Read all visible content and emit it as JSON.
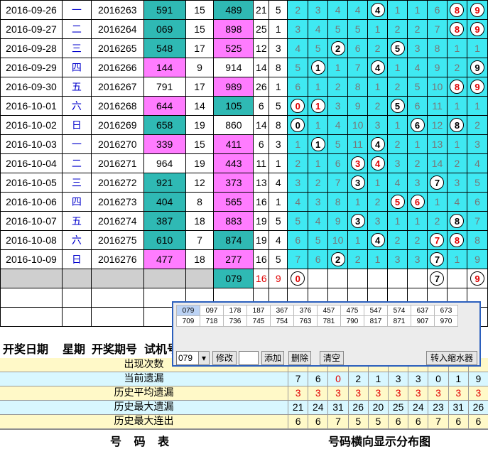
{
  "rows": [
    {
      "date": "2016-09-26",
      "wd": "一",
      "issue": "2016263",
      "test": "591",
      "tt": "teal",
      "s1": "15",
      "draw": "489",
      "dc": "teal",
      "a": "21",
      "b": "5",
      "d": [
        {
          "v": "2"
        },
        {
          "v": "3"
        },
        {
          "v": "4"
        },
        {
          "v": "4"
        },
        {
          "v": "4",
          "ball": true
        },
        {
          "v": "1"
        },
        {
          "v": "1"
        },
        {
          "v": "6"
        },
        {
          "v": "8",
          "ball": true,
          "red": true
        },
        {
          "v": "9",
          "ball": true,
          "red": true
        }
      ]
    },
    {
      "date": "2016-09-27",
      "wd": "二",
      "issue": "2016264",
      "test": "069",
      "tt": "teal",
      "s1": "15",
      "draw": "898",
      "dc": "pink",
      "a": "25",
      "b": "1",
      "d": [
        {
          "v": "3"
        },
        {
          "v": "4"
        },
        {
          "v": "5"
        },
        {
          "v": "5"
        },
        {
          "v": "1"
        },
        {
          "v": "2"
        },
        {
          "v": "2"
        },
        {
          "v": "7"
        },
        {
          "v": "8",
          "ball": true,
          "red": true
        },
        {
          "v": "9",
          "ball": true,
          "red": true
        }
      ]
    },
    {
      "date": "2016-09-28",
      "wd": "三",
      "issue": "2016265",
      "test": "548",
      "tt": "teal",
      "s1": "17",
      "draw": "525",
      "dc": "pink",
      "a": "12",
      "b": "3",
      "d": [
        {
          "v": "4"
        },
        {
          "v": "5"
        },
        {
          "v": "2",
          "ball": true
        },
        {
          "v": "6"
        },
        {
          "v": "2"
        },
        {
          "v": "5",
          "ball": true
        },
        {
          "v": "3"
        },
        {
          "v": "8"
        },
        {
          "v": "1"
        },
        {
          "v": "1"
        }
      ]
    },
    {
      "date": "2016-09-29",
      "wd": "四",
      "issue": "2016266",
      "test": "144",
      "tt": "pink",
      "s1": "9",
      "draw": "914",
      "dc": "white",
      "a": "14",
      "b": "8",
      "d": [
        {
          "v": "5"
        },
        {
          "v": "1",
          "ball": true
        },
        {
          "v": "1"
        },
        {
          "v": "7"
        },
        {
          "v": "4",
          "ball": true
        },
        {
          "v": "1"
        },
        {
          "v": "4"
        },
        {
          "v": "9"
        },
        {
          "v": "2"
        },
        {
          "v": "9",
          "ball": true
        }
      ]
    },
    {
      "date": "2016-09-30",
      "wd": "五",
      "issue": "2016267",
      "test": "791",
      "tt": "white",
      "s1": "17",
      "draw": "989",
      "dc": "pink",
      "a": "26",
      "b": "1",
      "d": [
        {
          "v": "6"
        },
        {
          "v": "1"
        },
        {
          "v": "2"
        },
        {
          "v": "8"
        },
        {
          "v": "1"
        },
        {
          "v": "2"
        },
        {
          "v": "5"
        },
        {
          "v": "10"
        },
        {
          "v": "8",
          "ball": true,
          "red": true
        },
        {
          "v": "9",
          "ball": true,
          "red": true
        }
      ]
    },
    {
      "date": "2016-10-01",
      "wd": "六",
      "issue": "2016268",
      "test": "644",
      "tt": "pink",
      "s1": "14",
      "draw": "105",
      "dc": "teal",
      "a": "6",
      "b": "5",
      "d": [
        {
          "v": "0",
          "ball": true,
          "red": true
        },
        {
          "v": "1",
          "ball": true,
          "red": true
        },
        {
          "v": "3"
        },
        {
          "v": "9"
        },
        {
          "v": "2"
        },
        {
          "v": "5",
          "ball": true
        },
        {
          "v": "6"
        },
        {
          "v": "11"
        },
        {
          "v": "1"
        },
        {
          "v": "1"
        }
      ]
    },
    {
      "date": "2016-10-02",
      "wd": "日",
      "issue": "2016269",
      "test": "658",
      "tt": "teal",
      "s1": "19",
      "draw": "860",
      "dc": "white",
      "a": "14",
      "b": "8",
      "d": [
        {
          "v": "0",
          "ball": true
        },
        {
          "v": "1"
        },
        {
          "v": "4"
        },
        {
          "v": "10"
        },
        {
          "v": "3"
        },
        {
          "v": "1"
        },
        {
          "v": "6",
          "ball": true
        },
        {
          "v": "12"
        },
        {
          "v": "8",
          "ball": true
        },
        {
          "v": "2"
        }
      ]
    },
    {
      "date": "2016-10-03",
      "wd": "一",
      "issue": "2016270",
      "test": "339",
      "tt": "pink",
      "s1": "15",
      "draw": "411",
      "dc": "pink",
      "a": "6",
      "b": "3",
      "d": [
        {
          "v": "1"
        },
        {
          "v": "1",
          "ball": true
        },
        {
          "v": "5"
        },
        {
          "v": "11"
        },
        {
          "v": "4",
          "ball": true
        },
        {
          "v": "2"
        },
        {
          "v": "1"
        },
        {
          "v": "13"
        },
        {
          "v": "1"
        },
        {
          "v": "3"
        }
      ]
    },
    {
      "date": "2016-10-04",
      "wd": "二",
      "issue": "2016271",
      "test": "964",
      "tt": "white",
      "s1": "19",
      "draw": "443",
      "dc": "pink",
      "a": "11",
      "b": "1",
      "d": [
        {
          "v": "2"
        },
        {
          "v": "1"
        },
        {
          "v": "6"
        },
        {
          "v": "3",
          "ball": true,
          "red": true
        },
        {
          "v": "4",
          "ball": true,
          "red": true
        },
        {
          "v": "3"
        },
        {
          "v": "2"
        },
        {
          "v": "14"
        },
        {
          "v": "2"
        },
        {
          "v": "4"
        }
      ]
    },
    {
      "date": "2016-10-05",
      "wd": "三",
      "issue": "2016272",
      "test": "921",
      "tt": "teal",
      "s1": "12",
      "draw": "373",
      "dc": "pink",
      "a": "13",
      "b": "4",
      "d": [
        {
          "v": "3"
        },
        {
          "v": "2"
        },
        {
          "v": "7"
        },
        {
          "v": "3",
          "ball": true
        },
        {
          "v": "1"
        },
        {
          "v": "4"
        },
        {
          "v": "3"
        },
        {
          "v": "7",
          "ball": true
        },
        {
          "v": "3"
        },
        {
          "v": "5"
        }
      ]
    },
    {
      "date": "2016-10-06",
      "wd": "四",
      "issue": "2016273",
      "test": "404",
      "tt": "teal",
      "s1": "8",
      "draw": "565",
      "dc": "pink",
      "a": "16",
      "b": "1",
      "d": [
        {
          "v": "4"
        },
        {
          "v": "3"
        },
        {
          "v": "8"
        },
        {
          "v": "1"
        },
        {
          "v": "2"
        },
        {
          "v": "5",
          "ball": true,
          "red": true
        },
        {
          "v": "6",
          "ball": true,
          "red": true
        },
        {
          "v": "1"
        },
        {
          "v": "4"
        },
        {
          "v": "6"
        }
      ]
    },
    {
      "date": "2016-10-07",
      "wd": "五",
      "issue": "2016274",
      "test": "387",
      "tt": "teal",
      "s1": "18",
      "draw": "883",
      "dc": "pink",
      "a": "19",
      "b": "5",
      "d": [
        {
          "v": "5"
        },
        {
          "v": "4"
        },
        {
          "v": "9"
        },
        {
          "v": "3",
          "ball": true
        },
        {
          "v": "3"
        },
        {
          "v": "1"
        },
        {
          "v": "1"
        },
        {
          "v": "2"
        },
        {
          "v": "8",
          "ball": true
        },
        {
          "v": "7"
        }
      ]
    },
    {
      "date": "2016-10-08",
      "wd": "六",
      "issue": "2016275",
      "test": "610",
      "tt": "teal",
      "s1": "7",
      "draw": "874",
      "dc": "teal",
      "a": "19",
      "b": "4",
      "d": [
        {
          "v": "6"
        },
        {
          "v": "5"
        },
        {
          "v": "10"
        },
        {
          "v": "1"
        },
        {
          "v": "4",
          "ball": true
        },
        {
          "v": "2"
        },
        {
          "v": "2"
        },
        {
          "v": "7",
          "ball": true,
          "red": true
        },
        {
          "v": "8",
          "ball": true,
          "red": true
        },
        {
          "v": "8"
        }
      ]
    },
    {
      "date": "2016-10-09",
      "wd": "日",
      "issue": "2016276",
      "test": "477",
      "tt": "pink",
      "s1": "18",
      "draw": "277",
      "dc": "pink",
      "a": "16",
      "b": "5",
      "d": [
        {
          "v": "7"
        },
        {
          "v": "6"
        },
        {
          "v": "2",
          "ball": true
        },
        {
          "v": "2"
        },
        {
          "v": "1"
        },
        {
          "v": "3"
        },
        {
          "v": "3"
        },
        {
          "v": "7",
          "ball": true
        },
        {
          "v": "1"
        },
        {
          "v": "9"
        }
      ]
    }
  ],
  "pending": {
    "draw": "079",
    "a": "16",
    "b": "9",
    "d": [
      {
        "v": "0",
        "ball": true,
        "red": true
      },
      {
        "v": ""
      },
      {
        "v": ""
      },
      {
        "v": ""
      },
      {
        "v": ""
      },
      {
        "v": ""
      },
      {
        "v": ""
      },
      {
        "v": "7",
        "ball": true
      },
      {
        "v": ""
      },
      {
        "v": "9",
        "ball": true,
        "red": true
      }
    ]
  },
  "headers": {
    "date": "开奖日期",
    "week": "星期",
    "issue": "开奖期号",
    "test": "试机号"
  },
  "stats": [
    {
      "label": "出现次数",
      "bg": "#fff9c8",
      "red": false,
      "vals": []
    },
    {
      "label": "当前遗漏",
      "bg": "#d8f7ff",
      "red": false,
      "vals": [
        "7",
        "6",
        "0",
        "2",
        "1",
        "3",
        "3",
        "0",
        "1",
        "9"
      ],
      "hl": [
        2
      ]
    },
    {
      "label": "历史平均遗漏",
      "bg": "#fff9c8",
      "red": true,
      "vals": [
        "3",
        "3",
        "3",
        "3",
        "3",
        "3",
        "3",
        "3",
        "3",
        "3"
      ]
    },
    {
      "label": "历史最大遗漏",
      "bg": "#d8f7ff",
      "red": false,
      "vals": [
        "21",
        "24",
        "31",
        "26",
        "20",
        "25",
        "24",
        "23",
        "31",
        "26"
      ]
    },
    {
      "label": "历史最大连出",
      "bg": "#fff9c8",
      "red": false,
      "vals": [
        "6",
        "6",
        "7",
        "5",
        "5",
        "6",
        "6",
        "7",
        "6",
        "6"
      ]
    }
  ],
  "footer": {
    "left": "号  码  表",
    "right": "号码横向显示分布图"
  },
  "popup": {
    "row1": [
      "079",
      "097",
      "178",
      "187",
      "367",
      "376",
      "457",
      "475",
      "547",
      "574",
      "637",
      "673"
    ],
    "row2": [
      "709",
      "718",
      "736",
      "745",
      "754",
      "763",
      "781",
      "790",
      "817",
      "871",
      "907",
      "970"
    ],
    "select_value": "079",
    "modify": "修改",
    "add": "添加",
    "delete": "删除",
    "clear": "清空",
    "transfer": "转入缩水器"
  }
}
